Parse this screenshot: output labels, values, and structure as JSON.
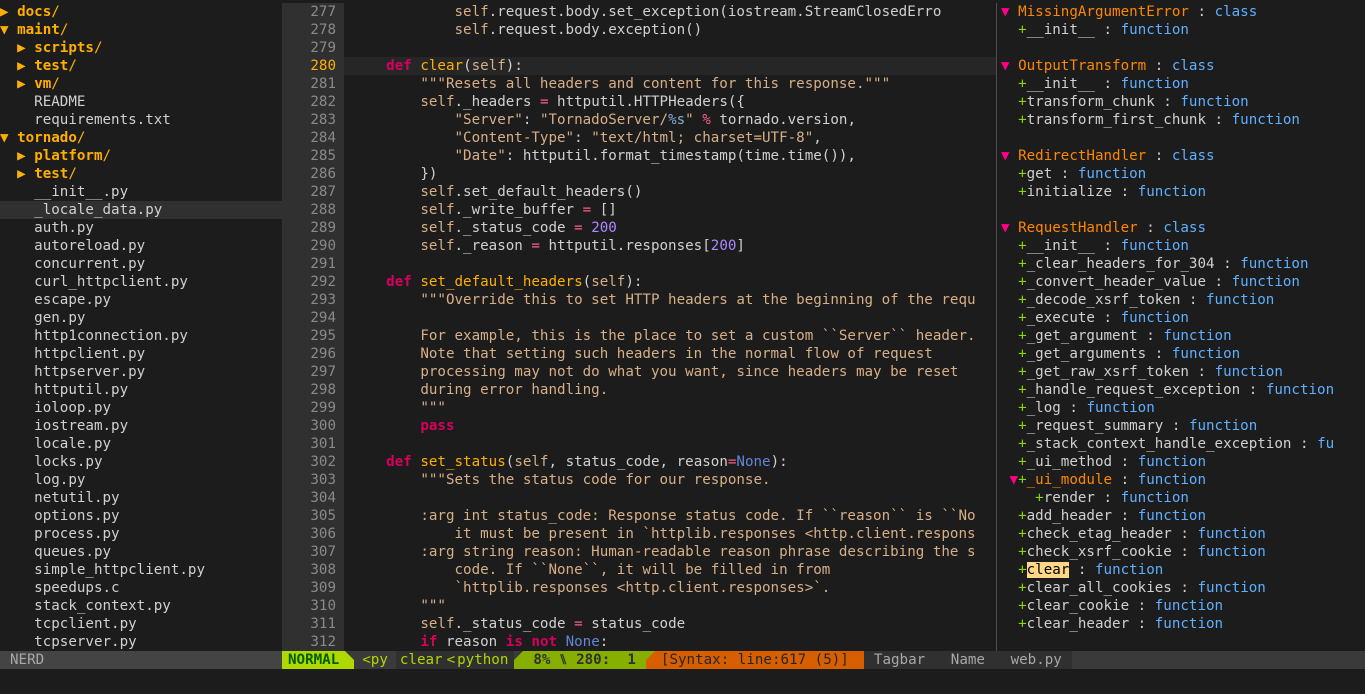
{
  "nerdtree": [
    {
      "indent": "",
      "arrow": "▶ ",
      "name": "docs",
      "dir": true
    },
    {
      "indent": "",
      "arrow": "▼ ",
      "name": "maint",
      "dir": true
    },
    {
      "indent": "  ",
      "arrow": "▶ ",
      "name": "scripts",
      "dir": true
    },
    {
      "indent": "  ",
      "arrow": "▶ ",
      "name": "test",
      "dir": true
    },
    {
      "indent": "  ",
      "arrow": "▶ ",
      "name": "vm",
      "dir": true
    },
    {
      "indent": "    ",
      "arrow": "",
      "name": "README",
      "dir": false
    },
    {
      "indent": "    ",
      "arrow": "",
      "name": "requirements.txt",
      "dir": false
    },
    {
      "indent": "",
      "arrow": "▼ ",
      "name": "tornado",
      "dir": true
    },
    {
      "indent": "  ",
      "arrow": "▶ ",
      "name": "platform",
      "dir": true
    },
    {
      "indent": "  ",
      "arrow": "▶ ",
      "name": "test",
      "dir": true
    },
    {
      "indent": "    ",
      "arrow": "",
      "name": "__init__.py",
      "dir": false
    },
    {
      "indent": "    ",
      "arrow": "",
      "name": "_locale_data.py",
      "dir": false,
      "selected": true
    },
    {
      "indent": "    ",
      "arrow": "",
      "name": "auth.py",
      "dir": false
    },
    {
      "indent": "    ",
      "arrow": "",
      "name": "autoreload.py",
      "dir": false
    },
    {
      "indent": "    ",
      "arrow": "",
      "name": "concurrent.py",
      "dir": false
    },
    {
      "indent": "    ",
      "arrow": "",
      "name": "curl_httpclient.py",
      "dir": false
    },
    {
      "indent": "    ",
      "arrow": "",
      "name": "escape.py",
      "dir": false
    },
    {
      "indent": "    ",
      "arrow": "",
      "name": "gen.py",
      "dir": false
    },
    {
      "indent": "    ",
      "arrow": "",
      "name": "http1connection.py",
      "dir": false
    },
    {
      "indent": "    ",
      "arrow": "",
      "name": "httpclient.py",
      "dir": false
    },
    {
      "indent": "    ",
      "arrow": "",
      "name": "httpserver.py",
      "dir": false
    },
    {
      "indent": "    ",
      "arrow": "",
      "name": "httputil.py",
      "dir": false
    },
    {
      "indent": "    ",
      "arrow": "",
      "name": "ioloop.py",
      "dir": false
    },
    {
      "indent": "    ",
      "arrow": "",
      "name": "iostream.py",
      "dir": false
    },
    {
      "indent": "    ",
      "arrow": "",
      "name": "locale.py",
      "dir": false
    },
    {
      "indent": "    ",
      "arrow": "",
      "name": "locks.py",
      "dir": false
    },
    {
      "indent": "    ",
      "arrow": "",
      "name": "log.py",
      "dir": false
    },
    {
      "indent": "    ",
      "arrow": "",
      "name": "netutil.py",
      "dir": false
    },
    {
      "indent": "    ",
      "arrow": "",
      "name": "options.py",
      "dir": false
    },
    {
      "indent": "    ",
      "arrow": "",
      "name": "process.py",
      "dir": false
    },
    {
      "indent": "    ",
      "arrow": "",
      "name": "queues.py",
      "dir": false
    },
    {
      "indent": "    ",
      "arrow": "",
      "name": "simple_httpclient.py",
      "dir": false
    },
    {
      "indent": "    ",
      "arrow": "",
      "name": "speedups.c",
      "dir": false
    },
    {
      "indent": "    ",
      "arrow": "",
      "name": "stack_context.py",
      "dir": false
    },
    {
      "indent": "    ",
      "arrow": "",
      "name": "tcpclient.py",
      "dir": false
    },
    {
      "indent": "    ",
      "arrow": "",
      "name": "tcpserver.py",
      "dir": false
    }
  ],
  "code": [
    {
      "n": "277",
      "t": [
        [
          "            ",
          ""
        ],
        [
          "self",
          "c"
        ],
        [
          ".request.body.set_exception(iostream.StreamClosedErro",
          ""
        ]
      ]
    },
    {
      "n": "278",
      "t": [
        [
          "            ",
          ""
        ],
        [
          "self",
          "c"
        ],
        [
          ".request.body.exception()",
          ""
        ]
      ]
    },
    {
      "n": "279",
      "t": []
    },
    {
      "n": "280",
      "cur": true,
      "t": [
        [
          "    ",
          ""
        ],
        [
          "def",
          "k"
        ],
        [
          " ",
          ""
        ],
        [
          "clear",
          "f"
        ],
        [
          "(",
          ""
        ],
        [
          "self",
          "c"
        ],
        [
          "):",
          ""
        ]
      ]
    },
    {
      "n": "281",
      "t": [
        [
          "        ",
          ""
        ],
        [
          "\"\"\"Resets all headers and content for this response.\"\"\"",
          "s"
        ]
      ]
    },
    {
      "n": "282",
      "t": [
        [
          "        ",
          ""
        ],
        [
          "self",
          "c"
        ],
        [
          "._headers ",
          ""
        ],
        [
          "=",
          "o"
        ],
        [
          " httputil.HTTPHeaders({",
          ""
        ]
      ]
    },
    {
      "n": "283",
      "t": [
        [
          "            ",
          ""
        ],
        [
          "\"Server\"",
          "s"
        ],
        [
          ": ",
          ""
        ],
        [
          "\"TornadoServer/",
          "s"
        ],
        [
          "%s",
          "sf"
        ],
        [
          "\"",
          "s"
        ],
        [
          " ",
          ""
        ],
        [
          "%",
          "o"
        ],
        [
          " tornado.version,",
          ""
        ]
      ]
    },
    {
      "n": "284",
      "t": [
        [
          "            ",
          ""
        ],
        [
          "\"Content-Type\"",
          "s"
        ],
        [
          ": ",
          ""
        ],
        [
          "\"text/html; charset=UTF-8\"",
          "s"
        ],
        [
          ",",
          ""
        ]
      ]
    },
    {
      "n": "285",
      "t": [
        [
          "            ",
          ""
        ],
        [
          "\"Date\"",
          "s"
        ],
        [
          ": httputil.format_timestamp(time.time()),",
          ""
        ]
      ]
    },
    {
      "n": "286",
      "t": [
        [
          "        })",
          ""
        ]
      ]
    },
    {
      "n": "287",
      "t": [
        [
          "        ",
          ""
        ],
        [
          "self",
          "c"
        ],
        [
          ".set_default_headers()",
          ""
        ]
      ]
    },
    {
      "n": "288",
      "t": [
        [
          "        ",
          ""
        ],
        [
          "self",
          "c"
        ],
        [
          "._write_buffer ",
          ""
        ],
        [
          "=",
          "o"
        ],
        [
          " []",
          ""
        ]
      ]
    },
    {
      "n": "289",
      "t": [
        [
          "        ",
          ""
        ],
        [
          "self",
          "c"
        ],
        [
          "._status_code ",
          ""
        ],
        [
          "=",
          "o"
        ],
        [
          " ",
          ""
        ],
        [
          "200",
          "n"
        ]
      ]
    },
    {
      "n": "290",
      "t": [
        [
          "        ",
          ""
        ],
        [
          "self",
          "c"
        ],
        [
          "._reason ",
          ""
        ],
        [
          "=",
          "o"
        ],
        [
          " httputil.responses[",
          ""
        ],
        [
          "200",
          "n"
        ],
        [
          "]",
          ""
        ]
      ]
    },
    {
      "n": "291",
      "t": []
    },
    {
      "n": "292",
      "t": [
        [
          "    ",
          ""
        ],
        [
          "def",
          "k"
        ],
        [
          " ",
          ""
        ],
        [
          "set_default_headers",
          "f"
        ],
        [
          "(",
          ""
        ],
        [
          "self",
          "c"
        ],
        [
          "):",
          ""
        ]
      ]
    },
    {
      "n": "293",
      "t": [
        [
          "        ",
          ""
        ],
        [
          "\"\"\"Override this to set HTTP headers at the beginning of the requ",
          "s"
        ]
      ]
    },
    {
      "n": "294",
      "t": []
    },
    {
      "n": "295",
      "t": [
        [
          "        ",
          ""
        ],
        [
          "For example, this is the place to set a custom ``Server`` header.",
          "s"
        ]
      ]
    },
    {
      "n": "296",
      "t": [
        [
          "        ",
          ""
        ],
        [
          "Note that setting such headers in the normal flow of request",
          "s"
        ]
      ]
    },
    {
      "n": "297",
      "t": [
        [
          "        ",
          ""
        ],
        [
          "processing may not do what you want, since headers may be reset",
          "s"
        ]
      ]
    },
    {
      "n": "298",
      "t": [
        [
          "        ",
          ""
        ],
        [
          "during error handling.",
          "s"
        ]
      ]
    },
    {
      "n": "299",
      "t": [
        [
          "        ",
          ""
        ],
        [
          "\"\"\"",
          "s"
        ]
      ]
    },
    {
      "n": "300",
      "t": [
        [
          "        ",
          ""
        ],
        [
          "pass",
          "k"
        ]
      ]
    },
    {
      "n": "301",
      "t": []
    },
    {
      "n": "302",
      "t": [
        [
          "    ",
          ""
        ],
        [
          "def",
          "k"
        ],
        [
          " ",
          ""
        ],
        [
          "set_status",
          "f"
        ],
        [
          "(",
          ""
        ],
        [
          "self",
          "c"
        ],
        [
          ", status_code, reason",
          ""
        ],
        [
          "=",
          "o"
        ],
        [
          "None",
          "bi"
        ],
        [
          "):",
          ""
        ]
      ]
    },
    {
      "n": "303",
      "t": [
        [
          "        ",
          ""
        ],
        [
          "\"\"\"Sets the status code for our response.",
          "s"
        ]
      ]
    },
    {
      "n": "304",
      "t": []
    },
    {
      "n": "305",
      "t": [
        [
          "        ",
          ""
        ],
        [
          ":arg int status_code: Response status code. If ``reason`` is ``No",
          "s"
        ]
      ]
    },
    {
      "n": "306",
      "t": [
        [
          "            ",
          ""
        ],
        [
          "it must be present in `httplib.responses <http.client.respons",
          "s"
        ]
      ]
    },
    {
      "n": "307",
      "t": [
        [
          "        ",
          ""
        ],
        [
          ":arg string reason: Human-readable reason phrase describing the s",
          "s"
        ]
      ]
    },
    {
      "n": "308",
      "t": [
        [
          "            ",
          ""
        ],
        [
          "code. If ``None``, it will be filled in from",
          "s"
        ]
      ]
    },
    {
      "n": "309",
      "t": [
        [
          "            ",
          ""
        ],
        [
          "`httplib.responses <http.client.responses>`.",
          "s"
        ]
      ]
    },
    {
      "n": "310",
      "t": [
        [
          "        ",
          ""
        ],
        [
          "\"\"\"",
          "s"
        ]
      ]
    },
    {
      "n": "311",
      "t": [
        [
          "        ",
          ""
        ],
        [
          "self",
          "c"
        ],
        [
          "._status_code ",
          ""
        ],
        [
          "=",
          "o"
        ],
        [
          " status_code",
          ""
        ]
      ]
    },
    {
      "n": "312",
      "t": [
        [
          "        ",
          ""
        ],
        [
          "if",
          "k"
        ],
        [
          " reason ",
          ""
        ],
        [
          "is",
          "k"
        ],
        [
          " ",
          ""
        ],
        [
          "not",
          "k"
        ],
        [
          " ",
          ""
        ],
        [
          "None",
          "bi"
        ],
        [
          ":",
          ""
        ]
      ]
    }
  ],
  "tagbar": [
    {
      "type": "class",
      "arrow": "▼ ",
      "name": "MissingArgumentError",
      "kind": "class"
    },
    {
      "type": "member",
      "indent": "  ",
      "name": "__init__",
      "kind": "function"
    },
    {
      "type": "blank"
    },
    {
      "type": "class",
      "arrow": "▼ ",
      "name": "OutputTransform",
      "kind": "class"
    },
    {
      "type": "member",
      "indent": "  ",
      "name": "__init__",
      "kind": "function"
    },
    {
      "type": "member",
      "indent": "  ",
      "name": "transform_chunk",
      "kind": "function"
    },
    {
      "type": "member",
      "indent": "  ",
      "name": "transform_first_chunk",
      "kind": "function"
    },
    {
      "type": "blank"
    },
    {
      "type": "class",
      "arrow": "▼ ",
      "name": "RedirectHandler",
      "kind": "class"
    },
    {
      "type": "member",
      "indent": "  ",
      "name": "get",
      "kind": "function"
    },
    {
      "type": "member",
      "indent": "  ",
      "name": "initialize",
      "kind": "function"
    },
    {
      "type": "blank"
    },
    {
      "type": "class",
      "arrow": "▼ ",
      "name": "RequestHandler",
      "kind": "class"
    },
    {
      "type": "member",
      "indent": "  ",
      "name": "__init__",
      "kind": "function"
    },
    {
      "type": "member",
      "indent": "  ",
      "name": "_clear_headers_for_304",
      "kind": "function"
    },
    {
      "type": "member",
      "indent": "  ",
      "name": "_convert_header_value",
      "kind": "function"
    },
    {
      "type": "member",
      "indent": "  ",
      "name": "_decode_xsrf_token",
      "kind": "function"
    },
    {
      "type": "member",
      "indent": "  ",
      "name": "_execute",
      "kind": "function"
    },
    {
      "type": "member",
      "indent": "  ",
      "name": "_get_argument",
      "kind": "function"
    },
    {
      "type": "member",
      "indent": "  ",
      "name": "_get_arguments",
      "kind": "function"
    },
    {
      "type": "member",
      "indent": "  ",
      "name": "_get_raw_xsrf_token",
      "kind": "function"
    },
    {
      "type": "member",
      "indent": "  ",
      "name": "_handle_request_exception",
      "kind": "function"
    },
    {
      "type": "member",
      "indent": "  ",
      "name": "_log",
      "kind": "function"
    },
    {
      "type": "member",
      "indent": "  ",
      "name": "_request_summary",
      "kind": "function"
    },
    {
      "type": "member",
      "indent": "  ",
      "name": "_stack_context_handle_exception",
      "kind": "fu"
    },
    {
      "type": "member",
      "indent": "  ",
      "name": "_ui_method",
      "kind": "function"
    },
    {
      "type": "fold",
      "indent": " ",
      "arrow": "▼",
      "name": "_ui_module",
      "kind": "function"
    },
    {
      "type": "member",
      "indent": "    ",
      "name": "render",
      "kind": "function"
    },
    {
      "type": "member",
      "indent": "  ",
      "name": "add_header",
      "kind": "function"
    },
    {
      "type": "member",
      "indent": "  ",
      "name": "check_etag_header",
      "kind": "function"
    },
    {
      "type": "member",
      "indent": "  ",
      "name": "check_xsrf_cookie",
      "kind": "function"
    },
    {
      "type": "member",
      "indent": "  ",
      "name": "clear",
      "kind": "function",
      "hl": true
    },
    {
      "type": "member",
      "indent": "  ",
      "name": "clear_all_cookies",
      "kind": "function"
    },
    {
      "type": "member",
      "indent": "  ",
      "name": "clear_cookie",
      "kind": "function"
    },
    {
      "type": "member",
      "indent": "  ",
      "name": "clear_header",
      "kind": "function"
    }
  ],
  "status": {
    "nerd_label": "NERD",
    "mode": "NORMAL",
    "filetype_short": "<py",
    "function_name": "clear",
    "sep": "<",
    "language": "python",
    "percent": "8%",
    "line_sym": "⑊",
    "line": "280:",
    "col": "1",
    "syntax_msg": "[Syntax: line:617 (5)]",
    "tagbar_label": "Tagbar",
    "tagbar_sort": "Name",
    "tagbar_file": "web.py"
  },
  "colors": {
    "mode_bg": "#afd700",
    "position_bg": "#87af00",
    "syntax_bg": "#d75f00"
  }
}
